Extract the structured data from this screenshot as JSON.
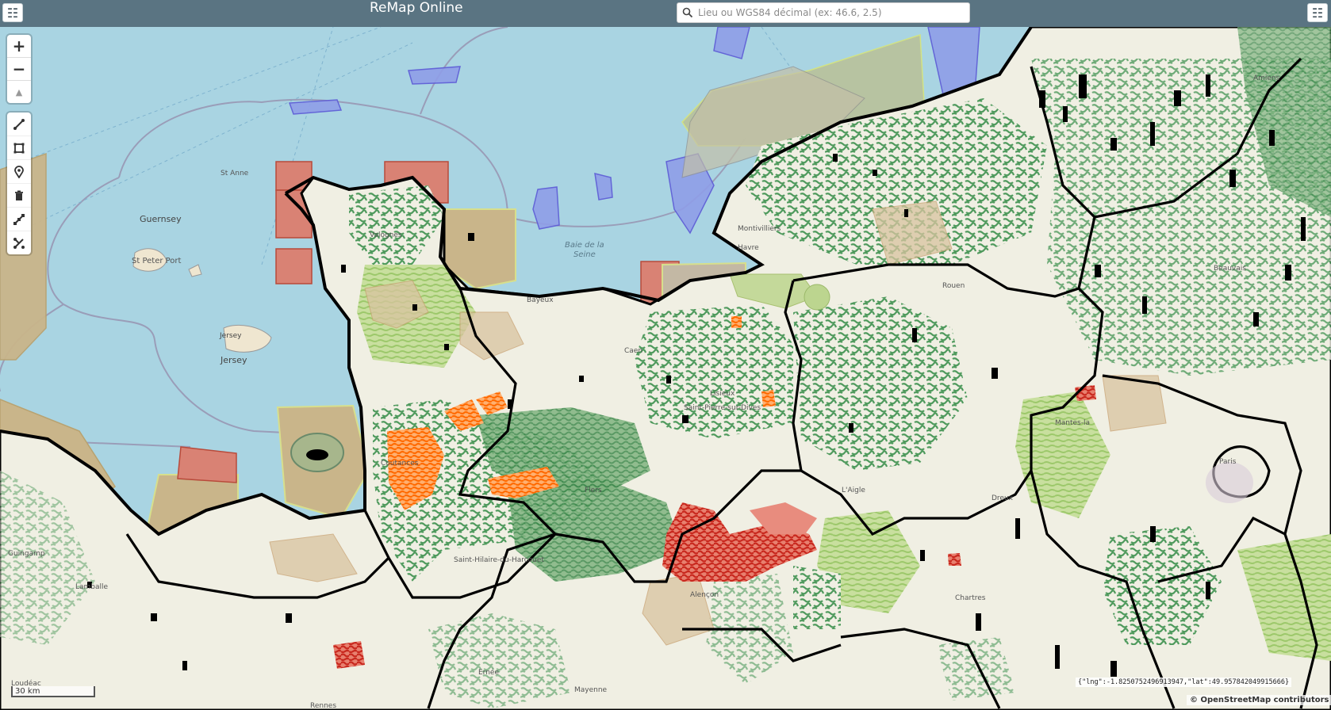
{
  "header": {
    "title": "ReMap Online",
    "search_placeholder": "Lieu ou WGS84 décimal (ex: 46.6, 2.5)"
  },
  "controls": {
    "zoom_in_label": "+",
    "zoom_out_label": "−",
    "reset_north_label": "▲",
    "tools": [
      "line-tool",
      "polygon-tool",
      "marker-tool",
      "delete-tool",
      "edit-tool",
      "split-tool"
    ]
  },
  "map": {
    "labels": {
      "guernsey": "Guernsey",
      "st_peter_port": "St Peter Port",
      "jersey_island": "Jersey",
      "jersey": "Jersey",
      "st_anne": "St Anne",
      "baie_de_seine_1": "Baie de la",
      "baie_de_seine_2": "Seine",
      "valognes": "Valognes",
      "bayeux": "Bayeux",
      "caen": "Caen",
      "montivilliers": "Montivilliers",
      "havre": "Havre",
      "paris": "Paris",
      "flers": "Flers",
      "laigle": "L'Aigle",
      "lamballe": "Lamballe",
      "guingamp": "Guingamp",
      "chartres": "Chartres",
      "mantes": "Mantes-la",
      "rouen": "Rouen",
      "amiens": "Amiens",
      "saint_hilaire": "Saint-Hilaire-du-Harcouet",
      "coutances": "Coutances",
      "loudeac": "Loudéac",
      "rennes": "Rennes",
      "mayenne": "Mayenne",
      "ernee": "Ernée",
      "lisieux": "Lisieux",
      "saint_pierre": "Saint-Pierre-sur-Dives",
      "alencon": "Alençon",
      "dreux": "Dreux",
      "beauvais": "Beauvais"
    },
    "colors": {
      "sea": "#a9d4e2",
      "land": "#f0efe3",
      "forest": "#5a9e63",
      "meadow": "#a8d27a",
      "hotspot_orange": "#ff7d16",
      "hotspot_red": "#d8352a",
      "protected_brown": "#c9a97a",
      "boundary": "#000000",
      "marine_zone_blue": "#8f9ee8",
      "marine_zone_red": "#d9877a"
    },
    "scale_label": "30 km",
    "cursor_readout": "{\"lng\":-1.8250752496913947,\"lat\":49.957842049915666}",
    "attribution": "© OpenStreetMap contributors"
  }
}
